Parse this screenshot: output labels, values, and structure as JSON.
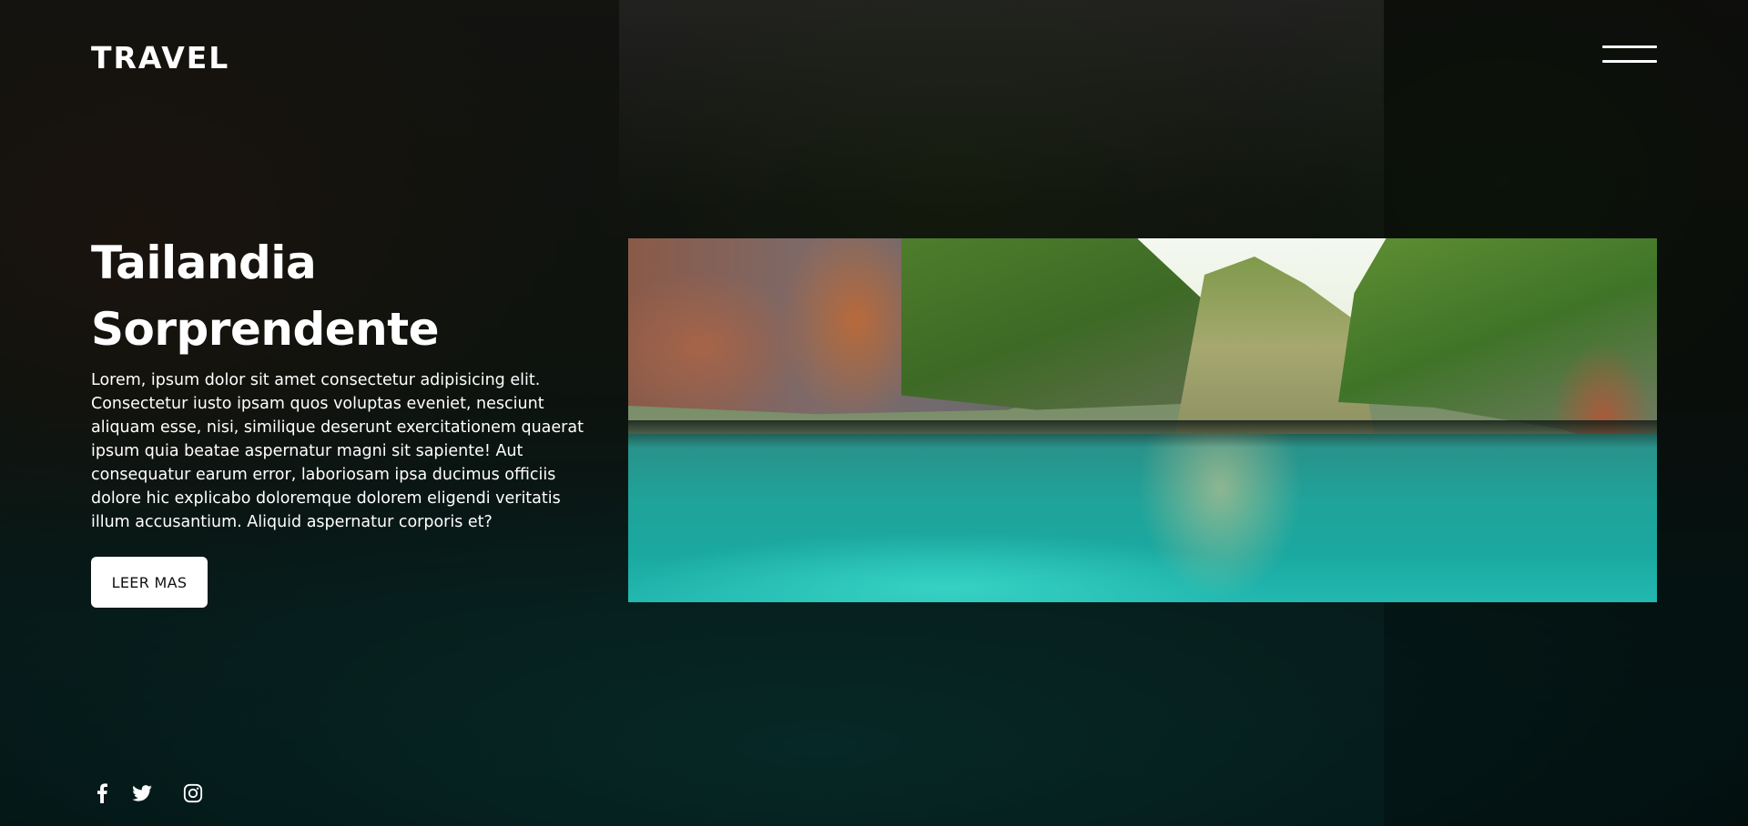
{
  "header": {
    "logo": "TRAVEL",
    "menu_icon": "hamburger-menu-icon"
  },
  "hero": {
    "title_line1": "Tailandia",
    "title_line2": "Sorprendente",
    "description": "Lorem, ipsum dolor sit amet consectetur adipisicing elit. Consectetur iusto ipsam quos voluptas eveniet, nesciunt aliquam esse, nisi, similique deserunt exercitationem quaerat ipsum quia beatae aspernatur magni sit sapiente! Aut consequatur earum error, laboriosam ipsa ducimus officiis dolore hic explicabo doloremque dolorem eligendi veritatis illum accusantium. Aliquid aspernatur corporis et?",
    "button_label": "LEER MAS"
  },
  "feature_image": {
    "subject": "turquoise lagoon between limestone cliffs"
  },
  "social": {
    "icons": [
      "facebook-icon",
      "twitter-icon",
      "instagram-icon"
    ]
  },
  "colors": {
    "text": "#ffffff",
    "button_bg": "#ffffff",
    "button_text": "#111111",
    "overlay": "#000000"
  }
}
